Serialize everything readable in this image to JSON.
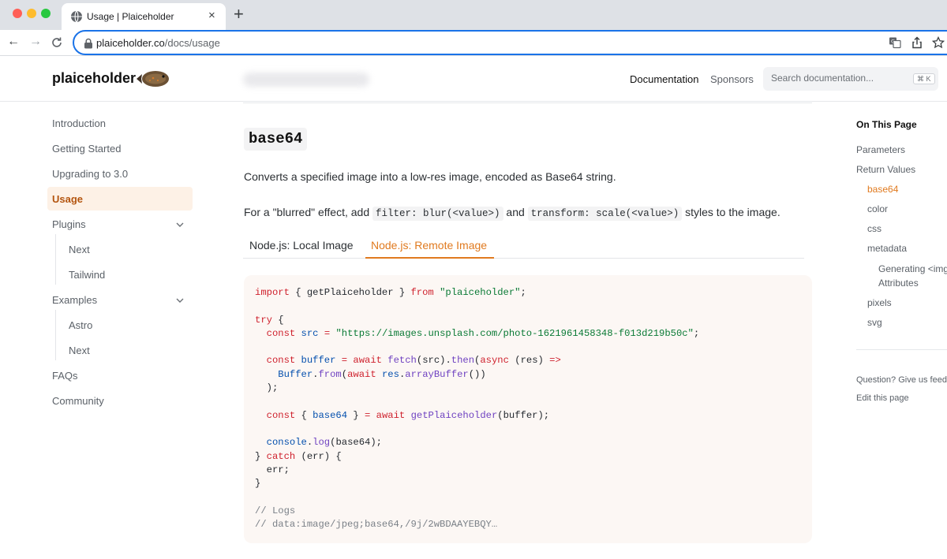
{
  "browser": {
    "tab_title": "Usage | Plaiceholder",
    "close_glyph": "×",
    "new_tab_glyph": "+",
    "back_glyph": "←",
    "forward_glyph": "→",
    "reload_glyph": "C",
    "url_host": "plaiceholder.co",
    "url_path": "/docs/usage"
  },
  "header": {
    "logo": "plaiceholder",
    "nav_documentation": "Documentation",
    "nav_sponsors": "Sponsors",
    "search_placeholder": "Search documentation...",
    "search_shortcut": "⌘ K"
  },
  "sidebar": {
    "introduction": "Introduction",
    "getting_started": "Getting Started",
    "upgrading": "Upgrading to 3.0",
    "usage": "Usage",
    "plugins": "Plugins",
    "plugins_next": "Next",
    "plugins_tailwind": "Tailwind",
    "examples": "Examples",
    "examples_astro": "Astro",
    "examples_next": "Next",
    "faqs": "FAQs",
    "community": "Community"
  },
  "main": {
    "heading": "base64",
    "description": "Converts a specified image into a low-res image, encoded as Base64 string.",
    "effect_prefix": "For a \"blurred\" effect, add ",
    "effect_code1": "filter: blur(<value>)",
    "effect_and": " and ",
    "effect_code2": "transform: scale(<value>)",
    "effect_suffix": " styles to the image.",
    "tab_local": "Node.js: Local Image",
    "tab_remote": "Node.js: Remote Image"
  },
  "code": {
    "l1_import": "import",
    "l1_mid": " { getPlaiceholder } ",
    "l1_from": "from",
    "l1_str": "\"plaiceholder\"",
    "l1_end": ";",
    "l2_try": "try",
    "l2_brace": " {",
    "l3_const": "const",
    "l3_src": "src",
    "l3_eq": " = ",
    "l3_url": "\"https://images.unsplash.com/photo-1621961458348-f013d219b50c\"",
    "l3_end": ";",
    "l4_const": "const",
    "l4_buffer": "buffer",
    "l4_eq": " = ",
    "l4_await": "await",
    "l4_fetch": "fetch",
    "l4_arg": "(src).",
    "l4_then": "then",
    "l4_paren": "(",
    "l4_async": "async",
    "l4_res": " (res) ",
    "l4_arrow": "=>",
    "l5_buffer": "Buffer",
    "l5_dot": ".",
    "l5_from": "from",
    "l5_paren": "(",
    "l5_await": "await",
    "l5_res": "res",
    "l5_dot2": ".",
    "l5_ab": "arrayBuffer",
    "l5_end": "())",
    "l6": ");",
    "l7_const": "const",
    "l7_open": " { ",
    "l7_b64": "base64",
    "l7_close": " } ",
    "l7_eq": "= ",
    "l7_await": "await",
    "l7_fn": "getPlaiceholder",
    "l7_end": "(buffer);",
    "l8_console": "console",
    "l8_dot": ".",
    "l8_log": "log",
    "l8_end": "(base64);",
    "l9_close": "} ",
    "l9_catch": "catch",
    "l9_end": " (err) {",
    "l10": "err;",
    "l11": "}",
    "l12": "// Logs",
    "l13": "// data:image/jpeg;base64,/9j/2wBDAAYEBQY…"
  },
  "toc": {
    "title": "On This Page",
    "parameters": "Parameters",
    "return_values": "Return Values",
    "base64": "base64",
    "color": "color",
    "css": "css",
    "metadata": "metadata",
    "generating": "Generating <img>",
    "attributes": "Attributes",
    "pixels": "pixels",
    "svg": "svg",
    "question": "Question? Give us feedback",
    "edit": "Edit this page"
  },
  "colors": {
    "accent": "#e07a1f",
    "active_bg": "#fdf1e6",
    "code_bg": "#fcf7f4",
    "omnibox_border": "#1a73e8"
  },
  "icons": {
    "favicon": "globe-icon",
    "lock": "lock-icon",
    "translate": "translate-icon",
    "share": "share-icon",
    "bookmark": "star-icon",
    "logo_fish": "flatfish-icon",
    "chevron": "chevron-down-icon"
  }
}
